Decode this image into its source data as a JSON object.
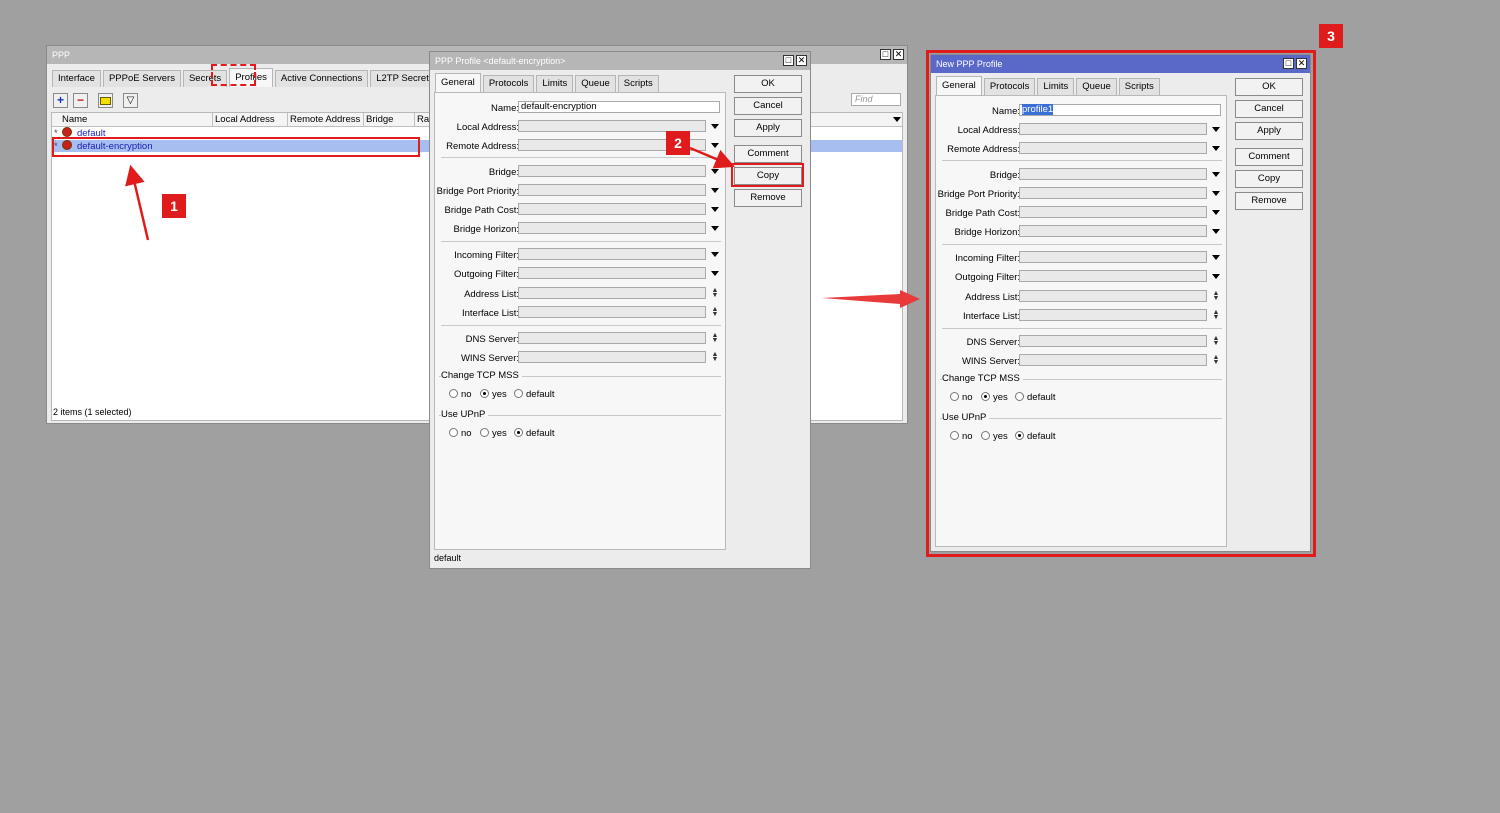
{
  "ppp_window": {
    "title": "PPP",
    "tabs": [
      "Interface",
      "PPPoE Servers",
      "Secrets",
      "Profiles",
      "Active Connections",
      "L2TP Secrets"
    ],
    "selected_tab": "Profiles",
    "find_placeholder": "Find",
    "columns": [
      "Name",
      "Local Address",
      "Remote Address",
      "Bridge",
      "Rat"
    ],
    "rows": [
      {
        "marker": "*",
        "name": "default"
      },
      {
        "marker": "*",
        "name": "default-encryption",
        "selected": true
      }
    ],
    "status": "2 items (1 selected)"
  },
  "profile_dialog": {
    "title": "PPP Profile <default-encryption>",
    "tabs": [
      "General",
      "Protocols",
      "Limits",
      "Queue",
      "Scripts"
    ],
    "fields": {
      "name": {
        "label": "Name:",
        "value": "default-encryption"
      },
      "local_address": {
        "label": "Local Address:"
      },
      "remote_address": {
        "label": "Remote Address:"
      },
      "bridge": {
        "label": "Bridge:"
      },
      "bridge_port_priority": {
        "label": "Bridge Port Priority:"
      },
      "bridge_path_cost": {
        "label": "Bridge Path Cost:"
      },
      "bridge_horizon": {
        "label": "Bridge Horizon:"
      },
      "incoming_filter": {
        "label": "Incoming Filter:"
      },
      "outgoing_filter": {
        "label": "Outgoing Filter:"
      },
      "address_list": {
        "label": "Address List:"
      },
      "interface_list": {
        "label": "Interface List:"
      },
      "dns_server": {
        "label": "DNS Server:"
      },
      "wins_server": {
        "label": "WINS Server:"
      }
    },
    "change_tcp_mss": {
      "label": "Change TCP MSS",
      "options": [
        "no",
        "yes",
        "default"
      ],
      "selected": "yes"
    },
    "use_upnp": {
      "label": "Use UPnP",
      "options": [
        "no",
        "yes",
        "default"
      ],
      "selected": "default"
    },
    "buttons": [
      "OK",
      "Cancel",
      "Apply",
      "Comment",
      "Copy",
      "Remove"
    ],
    "status": "default"
  },
  "new_profile_dialog": {
    "title": "New PPP Profile",
    "tabs": [
      "General",
      "Protocols",
      "Limits",
      "Queue",
      "Scripts"
    ],
    "fields": {
      "name": {
        "label": "Name:",
        "value": "profile1"
      },
      "local_address": {
        "label": "Local Address:"
      },
      "remote_address": {
        "label": "Remote Address:"
      },
      "bridge": {
        "label": "Bridge:"
      },
      "bridge_port_priority": {
        "label": "Bridge Port Priority:"
      },
      "bridge_path_cost": {
        "label": "Bridge Path Cost:"
      },
      "bridge_horizon": {
        "label": "Bridge Horizon:"
      },
      "incoming_filter": {
        "label": "Incoming Filter:"
      },
      "outgoing_filter": {
        "label": "Outgoing Filter:"
      },
      "address_list": {
        "label": "Address List:"
      },
      "interface_list": {
        "label": "Interface List:"
      },
      "dns_server": {
        "label": "DNS Server:"
      },
      "wins_server": {
        "label": "WINS Server:"
      }
    },
    "change_tcp_mss": {
      "label": "Change TCP MSS",
      "options": [
        "no",
        "yes",
        "default"
      ],
      "selected": "yes"
    },
    "use_upnp": {
      "label": "Use UPnP",
      "options": [
        "no",
        "yes",
        "default"
      ],
      "selected": "default"
    },
    "buttons": [
      "OK",
      "Cancel",
      "Apply",
      "Comment",
      "Copy",
      "Remove"
    ]
  },
  "annotations": {
    "step1": "1",
    "step2": "2",
    "step3": "3",
    "color": "#e01b1b"
  },
  "toolbar_icons": [
    "add-icon",
    "remove-icon",
    "comment-icon",
    "filter-icon"
  ]
}
